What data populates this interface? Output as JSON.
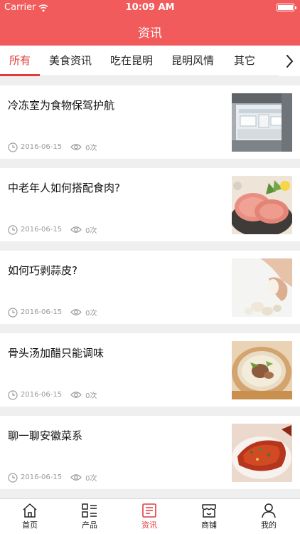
{
  "status_bar": {
    "carrier": "Carrier",
    "time": "10:09 AM"
  },
  "header": {
    "title": "资讯"
  },
  "categories": [
    {
      "label": "所有",
      "active": true
    },
    {
      "label": "美食资讯",
      "active": false
    },
    {
      "label": "吃在昆明",
      "active": false
    },
    {
      "label": "昆明风情",
      "active": false
    },
    {
      "label": "其它",
      "active": false
    }
  ],
  "articles": [
    {
      "title": "冷冻室为食物保驾护航",
      "date": "2016-06-15",
      "views": "0次",
      "thumbnail": "freezer-drawer-photo"
    },
    {
      "title": "中老年人如何搭配食肉?",
      "date": "2016-06-15",
      "views": "0次",
      "thumbnail": "sliced-ham-photo"
    },
    {
      "title": "如何巧剥蒜皮?",
      "date": "2016-06-15",
      "views": "0次",
      "thumbnail": "peeling-garlic-photo"
    },
    {
      "title": "骨头汤加醋只能调味",
      "date": "2016-06-15",
      "views": "0次",
      "thumbnail": "bone-soup-photo"
    },
    {
      "title": "聊一聊安徽菜系",
      "date": "2016-06-15",
      "views": "0次",
      "thumbnail": "anhui-dish-photo"
    }
  ],
  "tab_bar": [
    {
      "label": "首页",
      "icon": "home-icon"
    },
    {
      "label": "产品",
      "icon": "grid-list-icon"
    },
    {
      "label": "资讯",
      "icon": "news-icon",
      "active": true
    },
    {
      "label": "商铺",
      "icon": "shop-icon"
    },
    {
      "label": "我的",
      "icon": "person-icon"
    }
  ],
  "colors": {
    "brand": "#f15b5b",
    "active_text": "#e23b3b",
    "background": "#efefef",
    "meta_text": "#999999"
  }
}
